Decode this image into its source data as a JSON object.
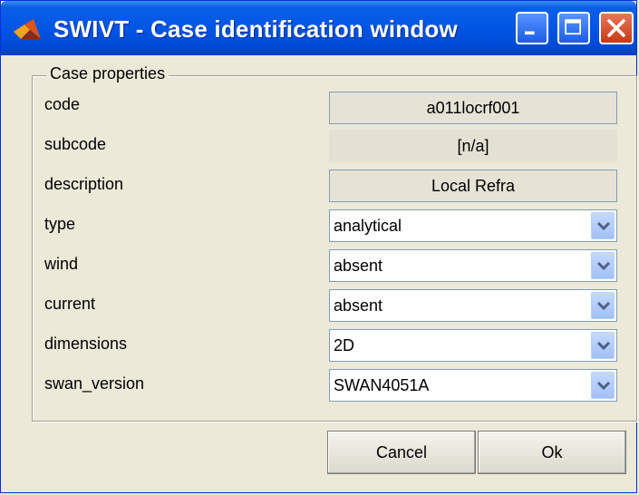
{
  "window": {
    "title": "SWIVT - Case identification window"
  },
  "group": {
    "title": "Case properties"
  },
  "fields": {
    "code": {
      "label": "code",
      "value": "a011locrf001"
    },
    "subcode": {
      "label": "subcode",
      "value": "[n/a]"
    },
    "description": {
      "label": "description",
      "value": "Local Refra"
    },
    "type": {
      "label": "type",
      "value": "analytical"
    },
    "wind": {
      "label": "wind",
      "value": "absent"
    },
    "current": {
      "label": "current",
      "value": "absent"
    },
    "dimensions": {
      "label": "dimensions",
      "value": "2D"
    },
    "swan_version": {
      "label": "swan_version",
      "value": "SWAN4051A"
    }
  },
  "buttons": {
    "cancel": "Cancel",
    "ok": "Ok"
  },
  "icons": {
    "app": "matlab-logo-icon",
    "minimize": "minimize-icon",
    "maximize": "maximize-icon",
    "close": "close-icon",
    "dropdown": "chevron-down-icon"
  },
  "colors": {
    "titlebar": "#0055e5",
    "window_bg": "#ece9d8",
    "close_button": "#c73a14"
  }
}
